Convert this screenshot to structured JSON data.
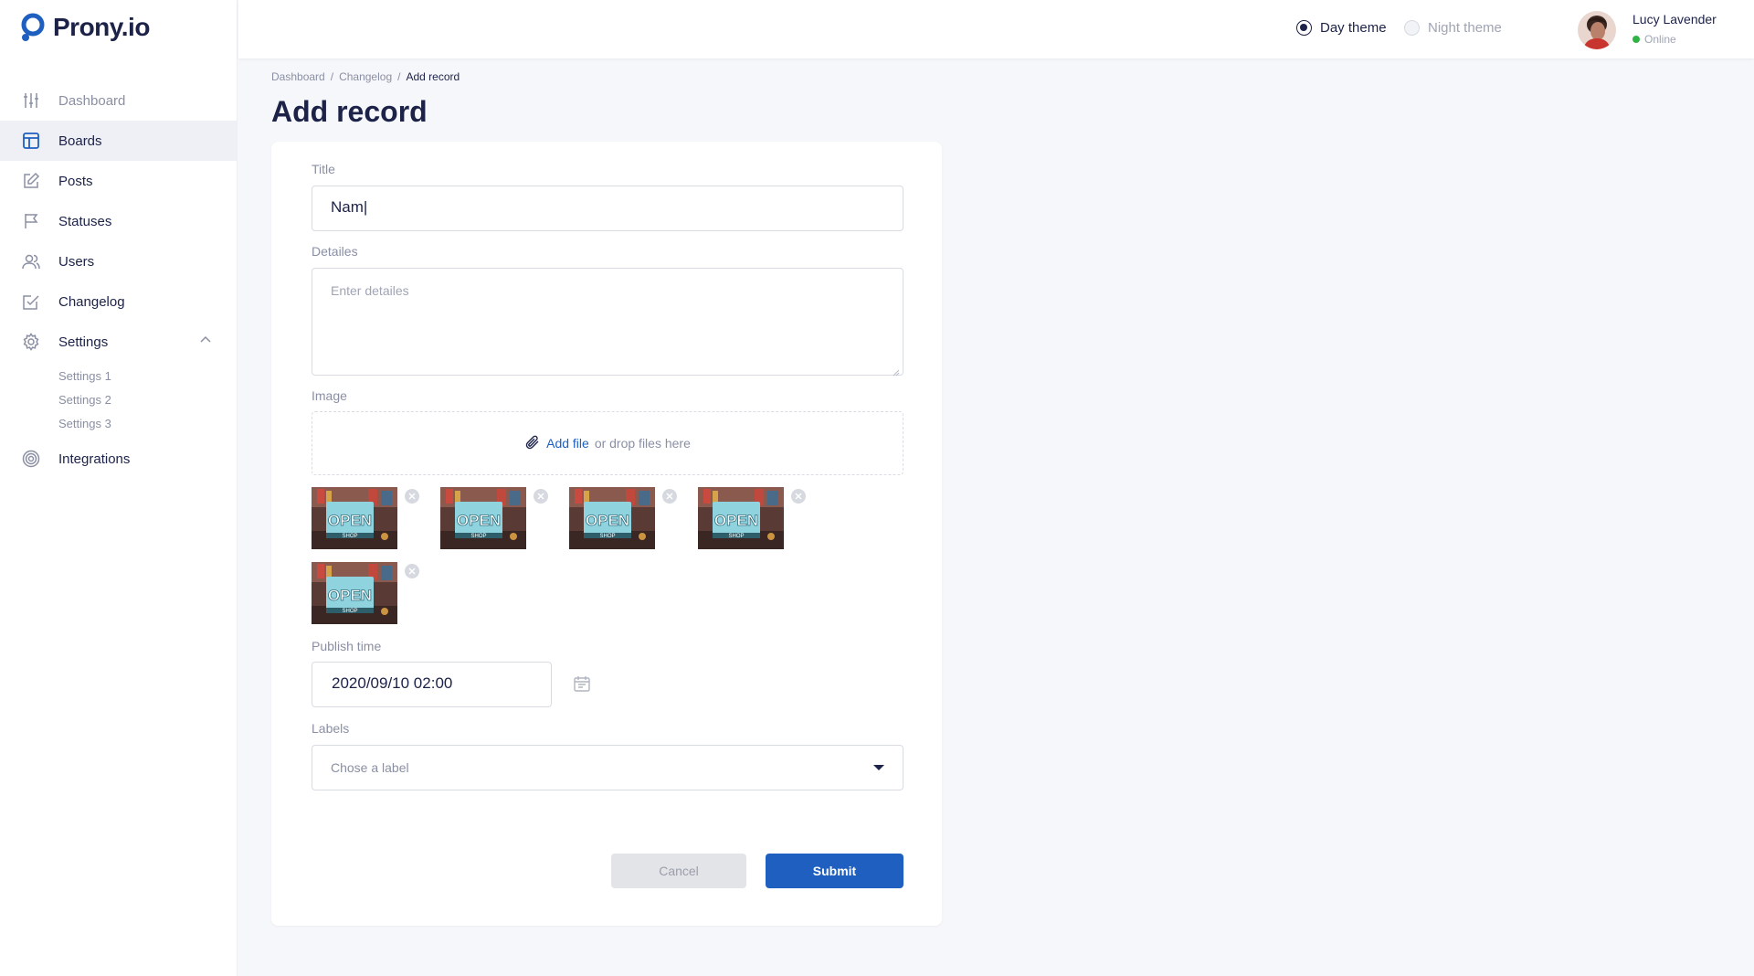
{
  "brand": {
    "name": "Prony.io",
    "color": "#1e5fbf"
  },
  "sidebar": {
    "items": [
      {
        "label": "Dashboard",
        "icon": "sliders-icon"
      },
      {
        "label": "Boards",
        "icon": "board-icon"
      },
      {
        "label": "Posts",
        "icon": "edit-icon"
      },
      {
        "label": "Statuses",
        "icon": "flag-icon"
      },
      {
        "label": "Users",
        "icon": "users-icon"
      },
      {
        "label": "Changelog",
        "icon": "checkbox-edit-icon"
      },
      {
        "label": "Settings",
        "icon": "gear-icon"
      },
      {
        "label": "Integrations",
        "icon": "target-icon"
      }
    ],
    "settings_sub": [
      "Settings 1",
      "Settings 2",
      "Settings 3"
    ]
  },
  "topbar": {
    "day_theme": "Day theme",
    "night_theme": "Night theme",
    "user_name": "Lucy Lavender",
    "user_status": "Online"
  },
  "breadcrumb": {
    "items": [
      "Dashboard",
      "Changelog",
      "Add record"
    ],
    "sep": "/"
  },
  "page": {
    "title": "Add record"
  },
  "form": {
    "title_label": "Title",
    "title_value": "Nam|",
    "details_label": "Detailes",
    "details_placeholder": "Enter detailes",
    "image_label": "Image",
    "add_file": "Add file",
    "drop_text": "or drop files here",
    "images": [
      {
        "caption": "OPEN",
        "sub": "SHOP"
      },
      {
        "caption": "OPEN",
        "sub": "SHOP"
      },
      {
        "caption": "OPEN",
        "sub": "SHOP"
      },
      {
        "caption": "OPEN",
        "sub": "SHOP"
      },
      {
        "caption": "OPEN",
        "sub": "SHOP"
      }
    ],
    "publish_label": "Publish time",
    "publish_value": "2020/09/10 02:00",
    "labels_label": "Labels",
    "labels_placeholder": "Chose a label",
    "cancel": "Cancel",
    "submit": "Submit"
  }
}
